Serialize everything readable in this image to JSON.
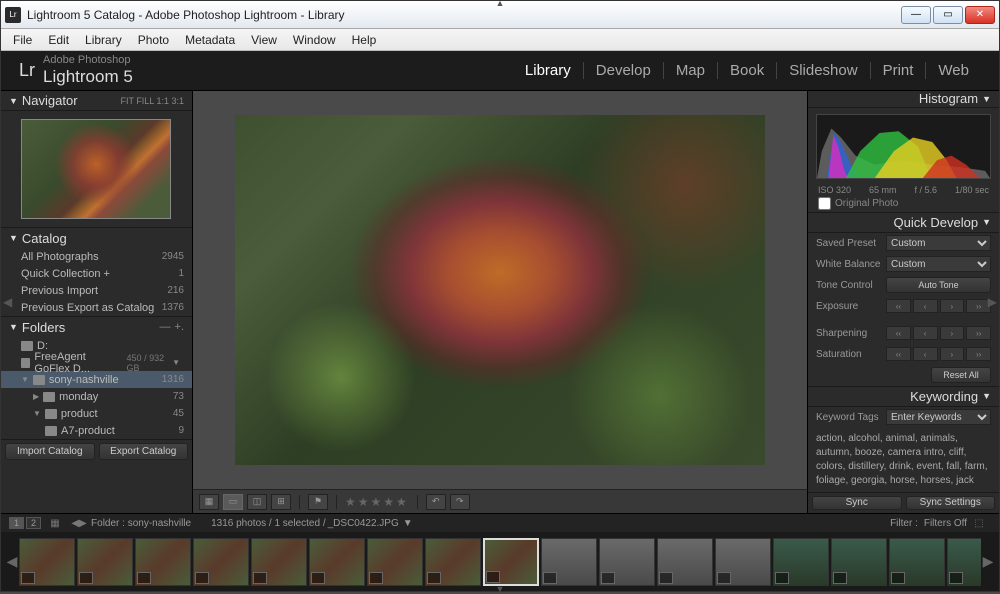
{
  "window": {
    "title": "Lightroom 5 Catalog - Adobe Photoshop Lightroom - Library"
  },
  "menu": [
    "File",
    "Edit",
    "Library",
    "Photo",
    "Metadata",
    "View",
    "Window",
    "Help"
  ],
  "brand": {
    "small": "Adobe Photoshop",
    "big": "Lightroom 5",
    "lr": "Lr"
  },
  "modules": [
    "Library",
    "Develop",
    "Map",
    "Book",
    "Slideshow",
    "Print",
    "Web"
  ],
  "activeModule": "Library",
  "navigator": {
    "title": "Navigator",
    "opts": "FIT   FILL   1:1   3:1"
  },
  "catalog": {
    "title": "Catalog",
    "items": [
      {
        "label": "All Photographs",
        "count": "2945"
      },
      {
        "label": "Quick Collection  +",
        "count": "1"
      },
      {
        "label": "Previous Import",
        "count": "216"
      },
      {
        "label": "Previous Export as Catalog",
        "count": "1376"
      }
    ]
  },
  "folders": {
    "title": "Folders",
    "drives": [
      {
        "label": "D:",
        "vol": ""
      },
      {
        "label": "FreeAgent GoFlex D...",
        "vol": "450 / 932 GB"
      }
    ],
    "tree": [
      {
        "label": "sony-nashville",
        "count": "1316",
        "depth": 0,
        "sel": true
      },
      {
        "label": "monday",
        "count": "73",
        "depth": 1
      },
      {
        "label": "product",
        "count": "45",
        "depth": 1
      },
      {
        "label": "A7-product",
        "count": "9",
        "depth": 2
      }
    ]
  },
  "buttons": {
    "import": "Import Catalog",
    "export": "Export Catalog",
    "sync": "Sync",
    "syncSettings": "Sync Settings"
  },
  "histogram": {
    "title": "Histogram",
    "iso": "ISO 320",
    "focal": "65 mm",
    "aperture": "f / 5.6",
    "shutter": "1/80 sec",
    "orig": "Original Photo"
  },
  "quickdev": {
    "title": "Quick Develop",
    "preset": {
      "lbl": "Saved Preset",
      "val": "Custom"
    },
    "wb": {
      "lbl": "White Balance",
      "val": "Custom"
    },
    "tone": {
      "lbl": "Tone Control",
      "btn": "Auto Tone"
    },
    "exposure": "Exposure",
    "sharpening": "Sharpening",
    "saturation": "Saturation",
    "reset": "Reset All"
  },
  "keywording": {
    "title": "Keywording",
    "tags": {
      "lbl": "Keyword Tags",
      "val": "Enter Keywords"
    },
    "list": "action, alcohol, animal, animals, autumn, booze, camera intro, cliff, colors, distillery, drink, event, fall, farm, foliage, georgia, horse, horses, jack"
  },
  "filmstrip": {
    "badges": [
      "1",
      "2"
    ],
    "path": "Folder : sony-nashville",
    "count": "1316 photos / 1 selected /",
    "file": "_DSC0422.JPG",
    "filter": "Filter :",
    "filterState": "Filters Off"
  }
}
